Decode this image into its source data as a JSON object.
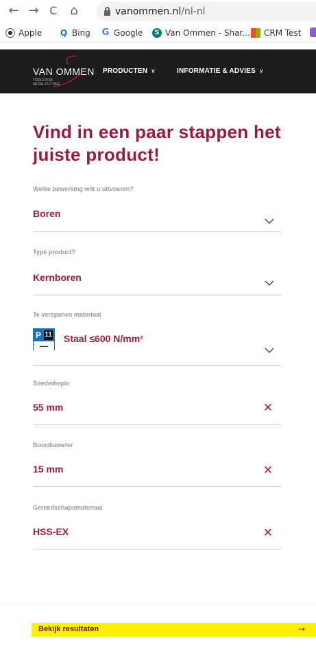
{
  "browser": {
    "url_domain": "vanommen.nl",
    "url_path": "/nl-nl",
    "nav_back": "←",
    "nav_forward": "→",
    "nav_reload": "C",
    "nav_home": "⌂",
    "bookmarks": [
      {
        "label": "Apple",
        "icon": "apple-icon"
      },
      {
        "label": "Bing",
        "icon": "search-icon"
      },
      {
        "label": "Google",
        "icon": "google-icon"
      },
      {
        "label": "Van Ommen - Shar...",
        "icon": "sharepoint-icon"
      },
      {
        "label": "CRM Test",
        "icon": "microsoft-icon"
      }
    ]
  },
  "header": {
    "logo_text": "VAN OMMEN",
    "logo_tagline": "TOOLS FOR METAL CUTTING",
    "menu": [
      {
        "label": "PRODUCTEN"
      },
      {
        "label": "INFORMATIE & ADVIES"
      }
    ]
  },
  "main": {
    "title": "Vind in een paar stappen het juiste product!",
    "fields": [
      {
        "label": "Welke bewerking wilt u uitvoeren?",
        "value": "Boren",
        "control": "dropdown"
      },
      {
        "label": "Type product?",
        "value": "Kernboren",
        "control": "dropdown"
      },
      {
        "label": "Te verspanen materiaal",
        "value": "Staal ≤600 N/mm²",
        "control": "dropdown",
        "badge_letter": "P",
        "badge_number": "11"
      },
      {
        "label": "Snedediepte",
        "value": "55 mm",
        "control": "clear"
      },
      {
        "label": "Boordiameter",
        "value": "15 mm",
        "control": "clear"
      },
      {
        "label": "Gereedschapsmateriaal",
        "value": "HSS-EX",
        "control": "clear"
      }
    ],
    "clear_symbol": "✕"
  },
  "footer": {
    "results_label": "Bekijk resultaten",
    "results_arrow": "→"
  },
  "colors": {
    "brand": "#9b1b3e",
    "header_bg": "#1c1c1c",
    "button_bg": "#fff200"
  }
}
